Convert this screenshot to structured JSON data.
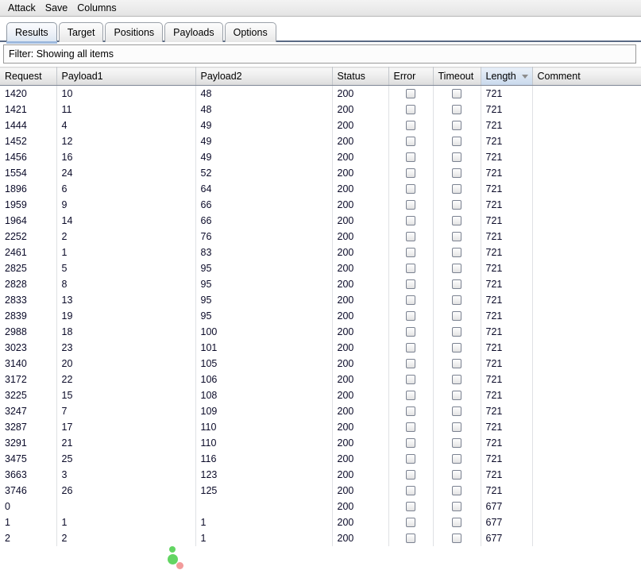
{
  "menubar": {
    "items": [
      {
        "label": "Attack"
      },
      {
        "label": "Save"
      },
      {
        "label": "Columns"
      }
    ]
  },
  "tabs": [
    {
      "label": "Results",
      "selected": true
    },
    {
      "label": "Target",
      "selected": false
    },
    {
      "label": "Positions",
      "selected": false
    },
    {
      "label": "Payloads",
      "selected": false
    },
    {
      "label": "Options",
      "selected": false
    }
  ],
  "filter": {
    "label": "Filter:",
    "text": "Showing all items",
    "full": "Filter:  Showing all items"
  },
  "table": {
    "columns": [
      {
        "key": "request",
        "label": "Request",
        "sorted": false
      },
      {
        "key": "payload1",
        "label": "Payload1",
        "sorted": false
      },
      {
        "key": "payload2",
        "label": "Payload2",
        "sorted": false
      },
      {
        "key": "status",
        "label": "Status",
        "sorted": false
      },
      {
        "key": "error",
        "label": "Error",
        "sorted": false
      },
      {
        "key": "timeout",
        "label": "Timeout",
        "sorted": false
      },
      {
        "key": "length",
        "label": "Length",
        "sorted": true,
        "sort_direction": "descending"
      },
      {
        "key": "comment",
        "label": "Comment",
        "sorted": false
      }
    ],
    "rows": [
      {
        "request": "1420",
        "payload1": "10",
        "payload2": "48",
        "status": "200",
        "error": false,
        "timeout": false,
        "length": "721",
        "comment": ""
      },
      {
        "request": "1421",
        "payload1": "11",
        "payload2": "48",
        "status": "200",
        "error": false,
        "timeout": false,
        "length": "721",
        "comment": ""
      },
      {
        "request": "1444",
        "payload1": "4",
        "payload2": "49",
        "status": "200",
        "error": false,
        "timeout": false,
        "length": "721",
        "comment": ""
      },
      {
        "request": "1452",
        "payload1": "12",
        "payload2": "49",
        "status": "200",
        "error": false,
        "timeout": false,
        "length": "721",
        "comment": ""
      },
      {
        "request": "1456",
        "payload1": "16",
        "payload2": "49",
        "status": "200",
        "error": false,
        "timeout": false,
        "length": "721",
        "comment": ""
      },
      {
        "request": "1554",
        "payload1": "24",
        "payload2": "52",
        "status": "200",
        "error": false,
        "timeout": false,
        "length": "721",
        "comment": ""
      },
      {
        "request": "1896",
        "payload1": "6",
        "payload2": "64",
        "status": "200",
        "error": false,
        "timeout": false,
        "length": "721",
        "comment": ""
      },
      {
        "request": "1959",
        "payload1": "9",
        "payload2": "66",
        "status": "200",
        "error": false,
        "timeout": false,
        "length": "721",
        "comment": ""
      },
      {
        "request": "1964",
        "payload1": "14",
        "payload2": "66",
        "status": "200",
        "error": false,
        "timeout": false,
        "length": "721",
        "comment": ""
      },
      {
        "request": "2252",
        "payload1": "2",
        "payload2": "76",
        "status": "200",
        "error": false,
        "timeout": false,
        "length": "721",
        "comment": ""
      },
      {
        "request": "2461",
        "payload1": "1",
        "payload2": "83",
        "status": "200",
        "error": false,
        "timeout": false,
        "length": "721",
        "comment": ""
      },
      {
        "request": "2825",
        "payload1": "5",
        "payload2": "95",
        "status": "200",
        "error": false,
        "timeout": false,
        "length": "721",
        "comment": ""
      },
      {
        "request": "2828",
        "payload1": "8",
        "payload2": "95",
        "status": "200",
        "error": false,
        "timeout": false,
        "length": "721",
        "comment": ""
      },
      {
        "request": "2833",
        "payload1": "13",
        "payload2": "95",
        "status": "200",
        "error": false,
        "timeout": false,
        "length": "721",
        "comment": ""
      },
      {
        "request": "2839",
        "payload1": "19",
        "payload2": "95",
        "status": "200",
        "error": false,
        "timeout": false,
        "length": "721",
        "comment": ""
      },
      {
        "request": "2988",
        "payload1": "18",
        "payload2": "100",
        "status": "200",
        "error": false,
        "timeout": false,
        "length": "721",
        "comment": ""
      },
      {
        "request": "3023",
        "payload1": "23",
        "payload2": "101",
        "status": "200",
        "error": false,
        "timeout": false,
        "length": "721",
        "comment": ""
      },
      {
        "request": "3140",
        "payload1": "20",
        "payload2": "105",
        "status": "200",
        "error": false,
        "timeout": false,
        "length": "721",
        "comment": ""
      },
      {
        "request": "3172",
        "payload1": "22",
        "payload2": "106",
        "status": "200",
        "error": false,
        "timeout": false,
        "length": "721",
        "comment": ""
      },
      {
        "request": "3225",
        "payload1": "15",
        "payload2": "108",
        "status": "200",
        "error": false,
        "timeout": false,
        "length": "721",
        "comment": ""
      },
      {
        "request": "3247",
        "payload1": "7",
        "payload2": "109",
        "status": "200",
        "error": false,
        "timeout": false,
        "length": "721",
        "comment": ""
      },
      {
        "request": "3287",
        "payload1": "17",
        "payload2": "110",
        "status": "200",
        "error": false,
        "timeout": false,
        "length": "721",
        "comment": ""
      },
      {
        "request": "3291",
        "payload1": "21",
        "payload2": "110",
        "status": "200",
        "error": false,
        "timeout": false,
        "length": "721",
        "comment": ""
      },
      {
        "request": "3475",
        "payload1": "25",
        "payload2": "116",
        "status": "200",
        "error": false,
        "timeout": false,
        "length": "721",
        "comment": ""
      },
      {
        "request": "3663",
        "payload1": "3",
        "payload2": "123",
        "status": "200",
        "error": false,
        "timeout": false,
        "length": "721",
        "comment": ""
      },
      {
        "request": "3746",
        "payload1": "26",
        "payload2": "125",
        "status": "200",
        "error": false,
        "timeout": false,
        "length": "721",
        "comment": ""
      },
      {
        "request": "0",
        "payload1": "",
        "payload2": "",
        "status": "200",
        "error": false,
        "timeout": false,
        "length": "677",
        "comment": ""
      },
      {
        "request": "1",
        "payload1": "1",
        "payload2": "1",
        "status": "200",
        "error": false,
        "timeout": false,
        "length": "677",
        "comment": ""
      },
      {
        "request": "2",
        "payload1": "2",
        "payload2": "1",
        "status": "200",
        "error": false,
        "timeout": false,
        "length": "677",
        "comment": ""
      }
    ]
  }
}
